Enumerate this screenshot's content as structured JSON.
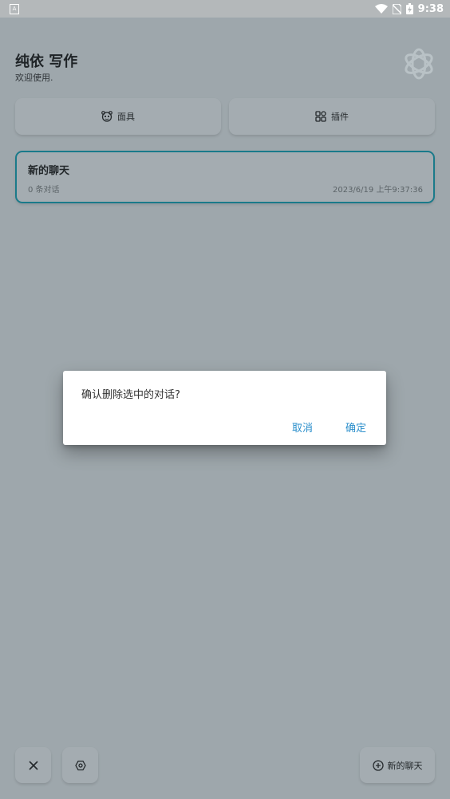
{
  "status_bar": {
    "time": "9:38",
    "left_icon": "A"
  },
  "header": {
    "title": "纯依 写作",
    "subtitle": "欢迎使用."
  },
  "top_buttons": {
    "masks": {
      "label": "面具",
      "icon": "mask-face-icon"
    },
    "plugins": {
      "label": "插件",
      "icon": "grid-apps-icon"
    }
  },
  "chat_list": [
    {
      "title": "新的聊天",
      "count": "0 条对话",
      "date": "2023/6/19 上午9:37:36"
    }
  ],
  "dialog": {
    "message": "确认删除选中的对话?",
    "cancel_label": "取消",
    "confirm_label": "确定"
  },
  "bottom_bar": {
    "new_chat_label": "新的聊天"
  },
  "colors": {
    "overlay_background": "#9ea7ac",
    "accent": "#2a8ecb",
    "selected_border": "#1a7a8a",
    "dialog_background": "#ffffff"
  }
}
